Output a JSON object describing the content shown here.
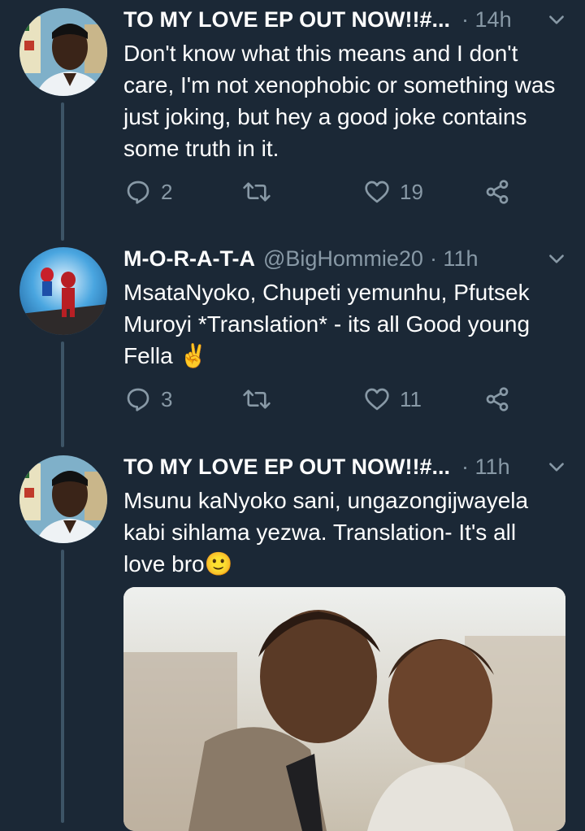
{
  "tweets": [
    {
      "name": "TO MY LOVE EP OUT NOW!!#...",
      "handle": "",
      "time": "· 14h",
      "text": "Don't know what this means and I don't care, I'm not xenophobic or something was just joking, but hey a good joke contains some truth in it.",
      "replies": "2",
      "retweets": "",
      "likes": "19"
    },
    {
      "name": "M-O-R-A-T-A",
      "handle": "@BigHommie20",
      "time": "· 11h",
      "text": "MsataNyoko, Chupeti yemunhu, Pfutsek Muroyi *Translation* - its all Good young Fella ✌",
      "replies": "3",
      "retweets": "",
      "likes": "11"
    },
    {
      "name": "TO MY LOVE EP OUT NOW!!#...",
      "handle": "",
      "time": "· 11h",
      "text": "Msunu kaNyoko sani, ungazongijwayela kabi sihlama yezwa. Translation- It's all love bro🙂"
    }
  ],
  "colors": {
    "background": "#1b2836",
    "muted": "#8899a6",
    "thread_line": "#3d5466"
  },
  "icons": [
    "reply-icon",
    "retweet-icon",
    "like-icon",
    "share-icon",
    "chevron-down-icon"
  ]
}
